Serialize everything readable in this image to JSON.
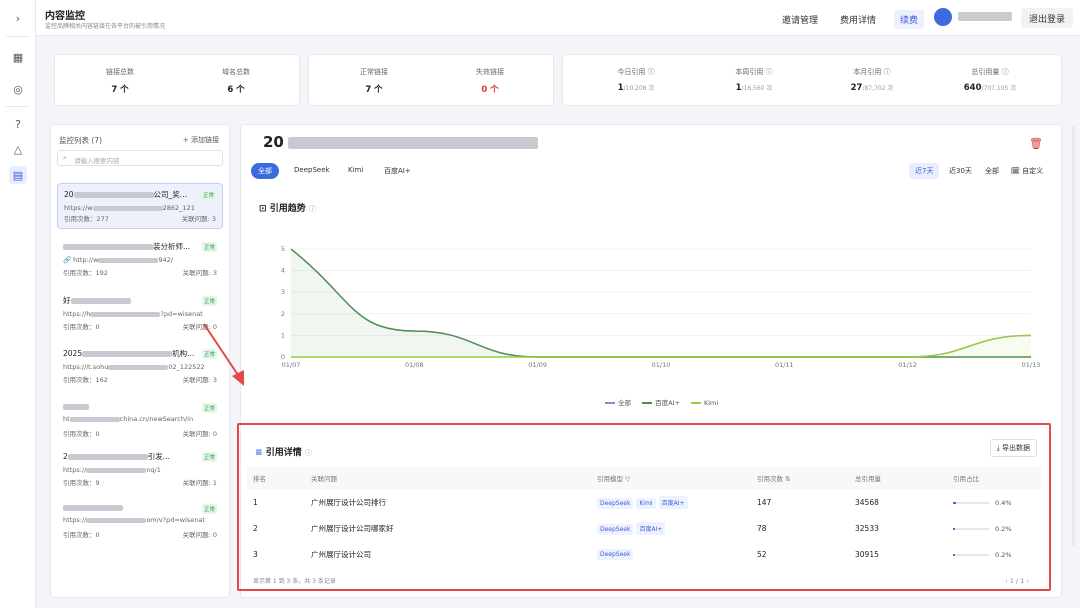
{
  "header": {
    "title": "内容监控",
    "subtitle": "监控品牌相关内容链接在各平台的被引用情况",
    "nav": [
      "邀请管理",
      "费用详情",
      "续费"
    ],
    "logout": "退出登录"
  },
  "stats": [
    {
      "label": "链接总数",
      "value": "7 个"
    },
    {
      "label": "域名总数",
      "value": "6 个"
    },
    {
      "label": "正常链接",
      "value": "7 个"
    },
    {
      "label": "失效链接",
      "value": "0 个"
    },
    {
      "label": "今日引用 ⓘ",
      "value": "1",
      "sub": "/10,208 次"
    },
    {
      "label": "本周引用 ⓘ",
      "value": "1",
      "sub": "/16,560 次"
    },
    {
      "label": "本月引用 ⓘ",
      "value": "27",
      "sub": "/87,702 次"
    },
    {
      "label": "总引用量 ⓘ",
      "value": "640",
      "sub": "/707,105 次"
    }
  ],
  "list": {
    "title": "监控列表 (7)",
    "add": "+ 添加链接",
    "search_placeholder": "请输入搜索内容",
    "items": [
      {
        "title": "20",
        "title_end": "公司_奖...",
        "url": "https://w",
        "url_end": "2862_121",
        "status": "正常",
        "cites": "引用次数：277",
        "related": "关联问题: 3"
      },
      {
        "title": "",
        "title_end": "装分析师...",
        "url": "🔗 http://w",
        "url_end": "942/",
        "status": "正常",
        "cites": "引用次数：192",
        "related": "关联问题: 3"
      },
      {
        "title": "好",
        "title_end": "",
        "url": "https://h",
        "url_end": "?pd=wisenat",
        "status": "正常",
        "cites": "引用次数：0",
        "related": "关联问题: 0"
      },
      {
        "title": "2025",
        "title_end": "机构...",
        "url": "https://it.sohu",
        "url_end": "02_122522",
        "status": "正常",
        "cites": "引用次数：162",
        "related": "关联问题: 3"
      },
      {
        "title": "",
        "title_end": "",
        "url": "ht",
        "url_end": "china.cn/newSearch/in",
        "status": "正常",
        "cites": "引用次数：0",
        "related": "关联问题: 0"
      },
      {
        "title": "2",
        "title_end": "引发...",
        "url": "https://",
        "url_end": "nq/1",
        "status": "正常",
        "cites": "引用次数：9",
        "related": "关联问题: 1"
      },
      {
        "title": "",
        "title_end": "",
        "url": "https://",
        "url_end": "om/v?pd=wisenat",
        "status": "正常",
        "cites": "引用次数：0",
        "related": "关联问题: 0"
      }
    ]
  },
  "main": {
    "title_prefix": "20",
    "platform_tabs": [
      "全部",
      "DeepSeek",
      "Kimi",
      "百度AI+"
    ],
    "ranges": [
      "近7天",
      "近30天",
      "全部",
      "🗓 自定义"
    ],
    "trend_title": "引用趋势",
    "detail_title": "引用详情",
    "export": "⤓ 导出数据",
    "table_headers": [
      "排名",
      "关联问题",
      "引用模型 ▽",
      "引用次数 ⇅",
      "总引用量",
      "引用占比"
    ],
    "rows": [
      {
        "rank": "1",
        "q": "广州展厅设计公司排行",
        "models": [
          "DeepSeek",
          "Kimi",
          "百度AI+"
        ],
        "cites": "147",
        "total": "34568",
        "pct": "0.4%",
        "ratio": 0.4
      },
      {
        "rank": "2",
        "q": "广州展厅设计公司哪家好",
        "models": [
          "DeepSeek",
          "百度AI+"
        ],
        "cites": "78",
        "total": "32533",
        "pct": "0.2%",
        "ratio": 0.2
      },
      {
        "rank": "3",
        "q": "广州展厅设计公司",
        "models": [
          "DeepSeek"
        ],
        "cites": "52",
        "total": "30915",
        "pct": "0.2%",
        "ratio": 0.2
      }
    ],
    "footer": "显示第 1 到 3 条，共 3 条记录",
    "pager": "‹  1 / 1  ›"
  },
  "chart_data": {
    "type": "line",
    "title": "引用趋势",
    "x": [
      "01/07",
      "01/08",
      "01/09",
      "01/10",
      "01/11",
      "01/12",
      "01/13"
    ],
    "ylim": [
      0,
      5
    ],
    "yticks": [
      "0",
      "1",
      "2",
      "3",
      "4",
      "5"
    ],
    "series": [
      {
        "name": "全部",
        "values": [
          5,
          1.2,
          0,
          0,
          0,
          0,
          1
        ],
        "color": "#7b8bd6"
      },
      {
        "name": "百度AI+",
        "values": [
          5,
          1.2,
          0,
          0,
          0,
          0,
          0
        ],
        "color": "#4d8f4a"
      },
      {
        "name": "Kimi",
        "values": [
          0,
          0,
          0,
          0,
          0,
          0,
          1
        ],
        "color": "#9acd3c"
      }
    ],
    "legend": "bottom"
  }
}
